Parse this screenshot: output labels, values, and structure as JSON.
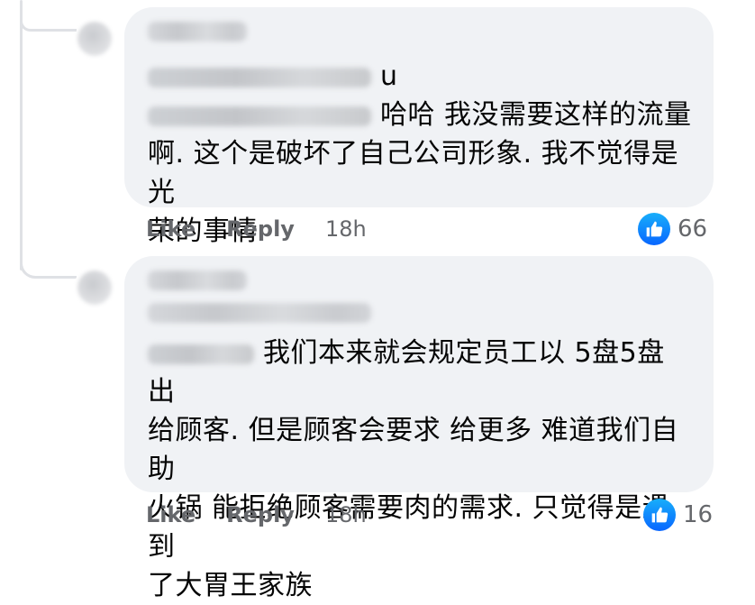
{
  "comments": [
    {
      "author_name": "",
      "text_line1_suffix": "u",
      "text_line2": "哈哈 我没需要这样的流量",
      "text_line3": "啊. 这个是破坏了自己公司形象. 我不觉得是光",
      "text_line4": "荣的事情",
      "like_label": "Like",
      "reply_label": "Reply",
      "time": "18h",
      "reaction_count": "66",
      "reaction_icon": "thumbs-up-icon"
    },
    {
      "author_name": "",
      "text_line1": "我们本来就会规定员工以 5盘5盘 出",
      "text_line2": "给顾客. 但是顾客会要求 给更多 难道我们自助",
      "text_line3": "火锅 能拒绝顾客需要肉的需求. 只觉得是遇到",
      "text_line4": "了大胃王家族",
      "like_label": "Like",
      "reply_label": "Reply",
      "time": "18h",
      "reaction_count": "16",
      "reaction_icon": "thumbs-up-icon"
    }
  ],
  "colors": {
    "bubble_bg": "#f0f2f5",
    "meta_text": "#65676b",
    "like_blue": "#0866ff",
    "thread_line": "#dfe1e5"
  }
}
